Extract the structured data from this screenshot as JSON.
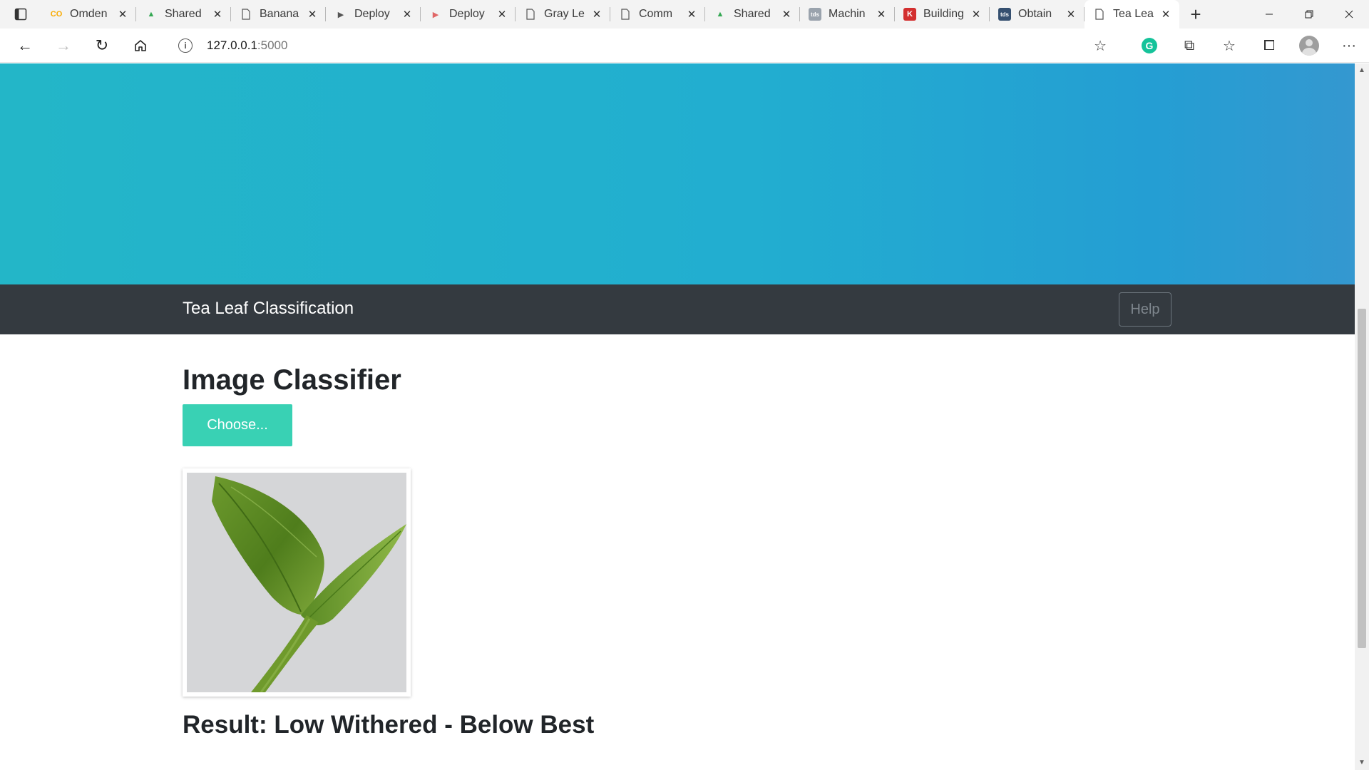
{
  "browser": {
    "tabs": [
      {
        "label": "Omden",
        "favicon": "colab-icon",
        "favicon_text": "CO",
        "favicon_color": "#f9ab00",
        "active": false
      },
      {
        "label": "Shared",
        "favicon": "google-drive-icon",
        "favicon_text": "▲",
        "favicon_color": "#34a853",
        "active": false
      },
      {
        "label": "Banana",
        "favicon": "page-icon",
        "favicon_text": "",
        "favicon_color": "#555555",
        "active": false
      },
      {
        "label": "Deploy",
        "favicon": "video-icon",
        "favicon_text": "▶",
        "favicon_color": "#555555",
        "active": false
      },
      {
        "label": "Deploy",
        "favicon": "youtube-icon",
        "favicon_text": "▶",
        "favicon_color": "#e06666",
        "active": false
      },
      {
        "label": "Gray Le",
        "favicon": "page-icon",
        "favicon_text": "",
        "favicon_color": "#555555",
        "active": false
      },
      {
        "label": "Comm",
        "favicon": "page-icon",
        "favicon_text": "",
        "favicon_color": "#555555",
        "active": false
      },
      {
        "label": "Shared",
        "favicon": "google-drive-icon",
        "favicon_text": "▲",
        "favicon_color": "#34a853",
        "active": false
      },
      {
        "label": "Machin",
        "favicon": "tds-icon",
        "favicon_text": "tds",
        "favicon_color": "#9aa3ad",
        "active": false
      },
      {
        "label": "Building",
        "favicon": "kaggle-icon",
        "favicon_text": "K",
        "favicon_color": "#d32f2f",
        "active": false
      },
      {
        "label": "Obtain",
        "favicon": "tds-icon",
        "favicon_text": "tds",
        "favicon_color": "#355070",
        "active": false
      },
      {
        "label": "Tea Lea",
        "favicon": "page-icon",
        "favicon_text": "",
        "favicon_color": "#555555",
        "active": true
      }
    ],
    "new_tab_label": "+",
    "address": {
      "host": "127.0.0.1",
      "port": ":5000"
    }
  },
  "page": {
    "navbar": {
      "brand": "Tea Leaf Classification",
      "help_label": "Help"
    },
    "main": {
      "title": "Image Classifier",
      "choose_label": "Choose...",
      "result": "Result: Low Withered - Below Best"
    },
    "colors": {
      "hero_start": "#23b6c8",
      "hero_end": "#3498d0",
      "navbar_bg": "#343a40",
      "choose_bg": "#39d1b4"
    }
  }
}
